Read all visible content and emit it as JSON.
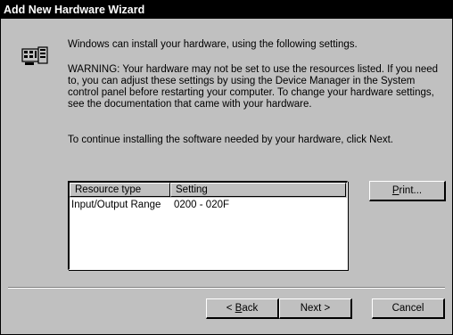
{
  "window": {
    "title": "Add New Hardware Wizard"
  },
  "content": {
    "icon": "hardware-device-icon",
    "intro": "Windows can install your hardware, using the following settings.",
    "warning": "WARNING: Your hardware may not be set to use the resources listed. If you need to, you can adjust these settings by using the Device Manager in the System control panel before restarting your computer. To change your hardware settings, see the documentation that came with your hardware.",
    "continue": "To continue installing the software needed by your hardware, click Next."
  },
  "resources": {
    "columns": [
      "Resource type",
      "Setting"
    ],
    "rows": [
      {
        "type": "Input/Output Range",
        "setting": "0200 - 020F"
      }
    ]
  },
  "buttons": {
    "print": {
      "key": "P",
      "rest": "rint..."
    },
    "back": {
      "pre": "< ",
      "key": "B",
      "rest": "ack"
    },
    "next": "Next >",
    "cancel": "Cancel"
  }
}
